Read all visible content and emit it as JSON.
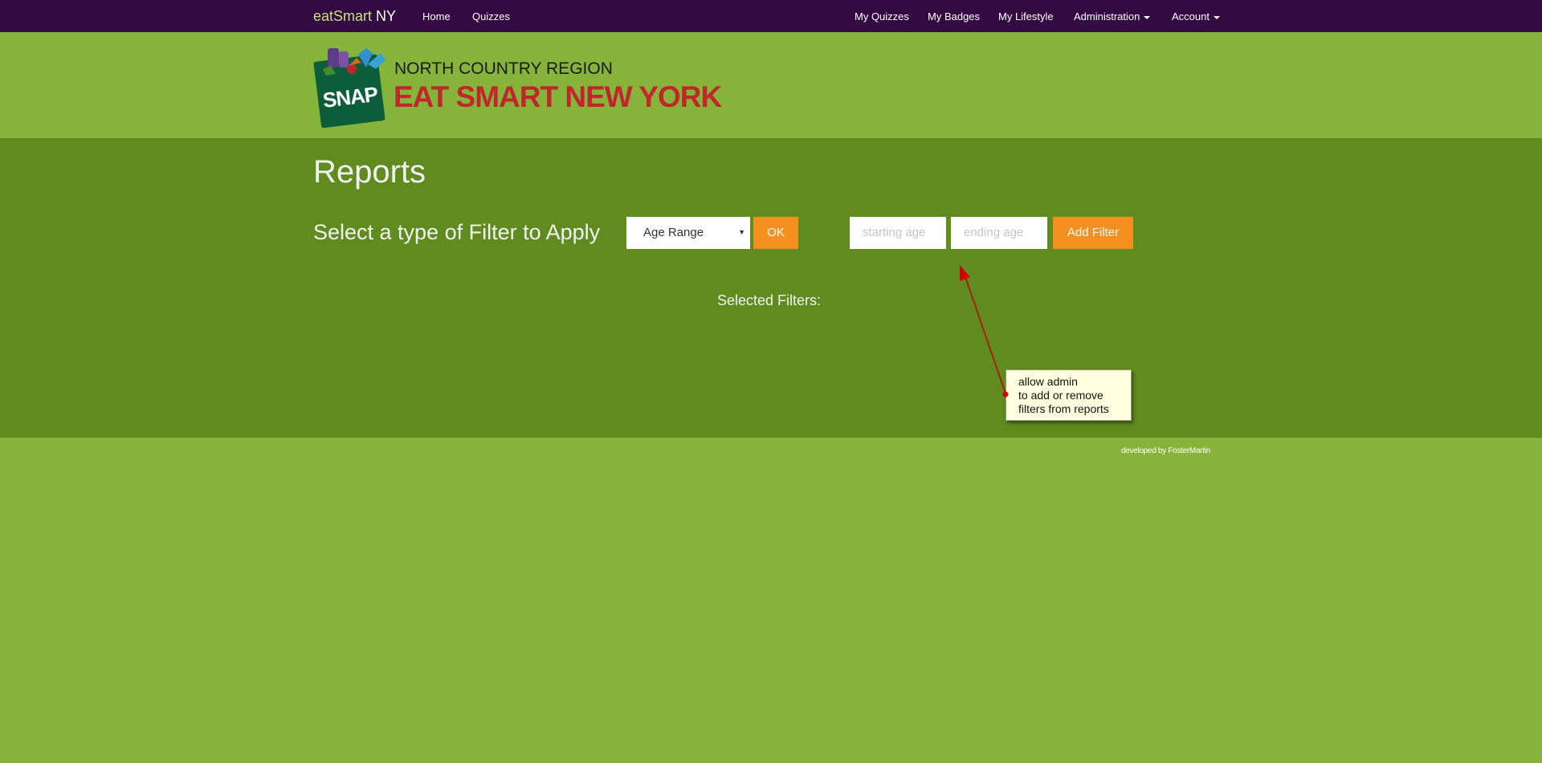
{
  "navbar": {
    "brand_part1": "eatSmart",
    "brand_part2": " NY",
    "left_links": [
      "Home",
      "Quizzes"
    ],
    "right_links": [
      "My Quizzes",
      "My Badges",
      "My Lifestyle"
    ],
    "dropdowns": [
      "Administration",
      "Account"
    ]
  },
  "header": {
    "logo_text": "SNAP",
    "region": "NORTH COUNTRY REGION",
    "title": "EAT SMART NEW YORK"
  },
  "main": {
    "page_title": "Reports",
    "filter_prompt": "Select a type of Filter to Apply",
    "filter_type_selected": "Age Range",
    "ok_label": "OK",
    "starting_age_placeholder": "starting age",
    "ending_age_placeholder": "ending age",
    "add_filter_label": "Add Filter",
    "selected_filters_label": "Selected Filters:"
  },
  "annotation": {
    "lines": [
      "allow admin",
      "to add or remove",
      "filters from reports"
    ]
  },
  "footer": {
    "credit": "developed by FosterMartin"
  },
  "colors": {
    "navbar": "#330a42",
    "page_background": "#86b43a",
    "main_background": "#608b1f",
    "button": "#f3901f",
    "brand_title": "#c0272d"
  },
  "icons": {
    "select_arrow": "triangle-down-icon",
    "dropdown_caret": "caret-down-icon",
    "logo": "snap-bag-logo-icon"
  }
}
